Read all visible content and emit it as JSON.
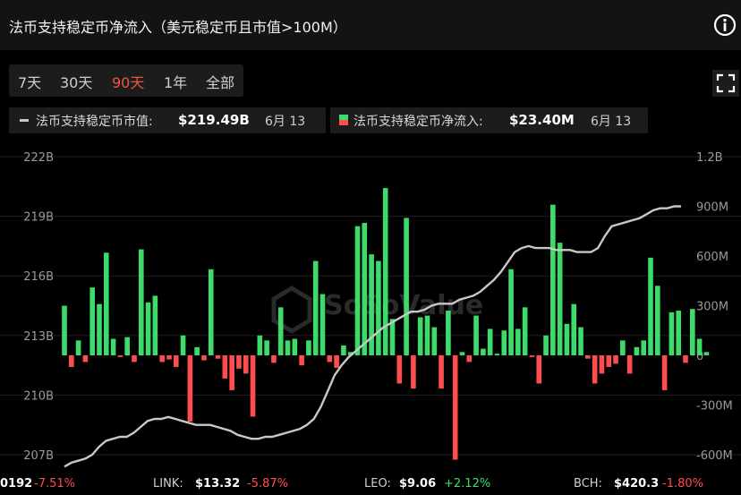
{
  "header": {
    "title": "法币支持稳定币净流入（美元稳定币且市值>100M）"
  },
  "tabs": [
    {
      "label": "7天",
      "active": false
    },
    {
      "label": "30天",
      "active": false
    },
    {
      "label": "90天",
      "active": true
    },
    {
      "label": "1年",
      "active": false
    },
    {
      "label": "全部",
      "active": false
    }
  ],
  "legend": {
    "cap": {
      "label": "法币支持稳定币市值:",
      "value": "$219.49B",
      "date": "6月 13"
    },
    "flow": {
      "label": "法币支持稳定币净流入:",
      "value": "$23.40M",
      "date": "6月 13"
    }
  },
  "colors": {
    "positive": "#3ddc6a",
    "negative": "#ff4d4d",
    "line": "#c8c8c8",
    "accent": "#f0553f"
  },
  "watermark": "SoSoValue",
  "chart_data": {
    "type": "bar",
    "x_count": 90,
    "y_left": {
      "ticks": [
        "222B",
        "219B",
        "216B",
        "213B",
        "210B",
        "207B"
      ],
      "ylim": [
        207,
        222
      ]
    },
    "y_right": {
      "ticks": [
        "1.2B",
        "900M",
        "600M",
        "300M",
        "0",
        "-300M",
        "-600M"
      ],
      "ylim": [
        -600,
        1200
      ]
    },
    "series": [
      {
        "type": "bar",
        "values": [
          300,
          -70,
          90,
          -40,
          410,
          310,
          620,
          100,
          -10,
          110,
          -40,
          640,
          320,
          360,
          -40,
          -25,
          -70,
          120,
          -400,
          50,
          -30,
          520,
          -20,
          -140,
          -210,
          -80,
          -110,
          -370,
          120,
          90,
          -45,
          290,
          90,
          100,
          -60,
          90,
          570,
          370,
          -40,
          -75,
          60,
          20,
          780,
          800,
          610,
          570,
          1010,
          220,
          -170,
          830,
          -200,
          230,
          240,
          170,
          -200,
          270,
          -630,
          20,
          -40,
          240,
          40,
          160,
          10,
          150,
          520,
          160,
          290,
          -10,
          -170,
          120,
          910,
          680,
          190,
          310,
          170,
          -20,
          -170,
          -110,
          -70,
          -50,
          90,
          -110,
          50,
          90,
          590,
          420,
          -210,
          260,
          270,
          -45,
          280,
          100,
          20
        ]
      },
      {
        "type": "line",
        "values": [
          206.4,
          206.6,
          206.7,
          206.8,
          207.0,
          207.4,
          207.7,
          207.8,
          207.9,
          207.9,
          208.1,
          208.4,
          208.7,
          208.8,
          208.8,
          208.9,
          208.8,
          208.7,
          208.6,
          208.5,
          208.5,
          208.5,
          208.4,
          208.3,
          208.2,
          208.0,
          207.9,
          207.8,
          207.8,
          207.9,
          207.9,
          208.0,
          208.1,
          208.2,
          208.3,
          208.5,
          208.8,
          209.4,
          210.2,
          211.0,
          211.5,
          211.9,
          212.2,
          212.5,
          212.8,
          213.1,
          213.4,
          213.6,
          213.8,
          214.0,
          214.2,
          214.2,
          214.3,
          214.5,
          214.6,
          214.6,
          214.6,
          214.8,
          214.9,
          215.0,
          215.2,
          215.5,
          215.8,
          216.2,
          216.7,
          217.2,
          217.4,
          217.5,
          217.4,
          217.4,
          217.4,
          217.3,
          217.3,
          217.3,
          217.2,
          217.2,
          217.2,
          217.4,
          218.0,
          218.5,
          218.6,
          218.7,
          218.8,
          218.9,
          219.1,
          219.3,
          219.4,
          219.4,
          219.5,
          219.5
        ]
      }
    ]
  },
  "ticker": [
    {
      "symbol": "",
      "price": "0192",
      "change": "-7.51%",
      "up": false
    },
    {
      "symbol": "LINK:",
      "price": "$13.32",
      "change": "-5.87%",
      "up": false
    },
    {
      "symbol": "LEO:",
      "price": "$9.06",
      "change": "+2.12%",
      "up": true
    },
    {
      "symbol": "BCH:",
      "price": "$420.3",
      "change": "-1.80%",
      "up": false
    }
  ]
}
